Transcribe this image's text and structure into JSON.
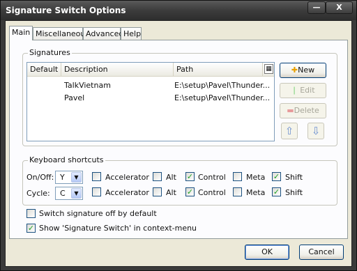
{
  "window": {
    "title": "Signature Switch Options",
    "minimize_glyph": "—",
    "close_glyph": "X"
  },
  "tabs": [
    {
      "label": "Main",
      "active": true
    },
    {
      "label": "Miscellaneous",
      "active": false
    },
    {
      "label": "Advanced",
      "active": false
    },
    {
      "label": "Help",
      "active": false
    }
  ],
  "signatures": {
    "group_label": "Signatures",
    "columns": [
      "Default",
      "Description",
      "Path"
    ],
    "column_picker_icon": "column-picker-icon",
    "rows": [
      {
        "default": "",
        "description": "TalkVietnam",
        "path": "E:\\setup\\Pavel\\Thunder..."
      },
      {
        "default": "",
        "description": "Pavel",
        "path": "E:\\setup\\Pavel\\Thunder..."
      }
    ],
    "buttons": {
      "new": "New",
      "edit": "Edit",
      "delete": "Delete"
    }
  },
  "keyboard": {
    "group_label": "Keyboard shortcuts",
    "rows": [
      {
        "label": "On/Off:",
        "key": "Y",
        "accelerator": false,
        "alt": false,
        "control": true,
        "meta": false,
        "shift": true
      },
      {
        "label": "Cycle:",
        "key": "C",
        "accelerator": false,
        "alt": false,
        "control": true,
        "meta": false,
        "shift": true
      }
    ],
    "modifier_labels": {
      "accelerator": "Accelerator",
      "alt": "Alt",
      "control": "Control",
      "meta": "Meta",
      "shift": "Shift"
    }
  },
  "options": [
    {
      "label": "Switch signature off by default",
      "checked": false
    },
    {
      "label": "Show 'Signature Switch' in context-menu",
      "checked": true
    }
  ],
  "footer": {
    "ok": "OK",
    "cancel": "Cancel"
  },
  "colors": {
    "titlebar": "#3c3c3c",
    "dialog_bg": "#ece9d8",
    "check_mark": "#21a121"
  }
}
